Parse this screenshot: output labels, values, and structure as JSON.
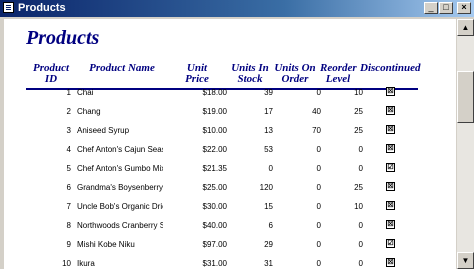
{
  "window": {
    "title": "Products",
    "min_label": "_",
    "max_label": "□",
    "close_label": "×"
  },
  "report": {
    "title": "Products",
    "headers": {
      "product_id": "Product ID",
      "product_name": "Product Name",
      "unit_price": "Unit Price",
      "units_in_stock_1": "Units In",
      "units_in_stock_2": "Stock",
      "units_on_order_1": "Units On",
      "units_on_order_2": "Order",
      "reorder_level_1": "Reorder",
      "reorder_level_2": "Level",
      "discontinued": "Discontinued"
    },
    "rows": [
      {
        "id": "1",
        "name": "Chai",
        "price": "$18.00",
        "stock": "39",
        "order": "0",
        "reorder": "10",
        "discontinued": "☒"
      },
      {
        "id": "2",
        "name": "Chang",
        "price": "$19.00",
        "stock": "17",
        "order": "40",
        "reorder": "25",
        "discontinued": "☒"
      },
      {
        "id": "3",
        "name": "Aniseed Syrup",
        "price": "$10.00",
        "stock": "13",
        "order": "70",
        "reorder": "25",
        "discontinued": "☒"
      },
      {
        "id": "4",
        "name": "Chef Anton's Cajun Seasoning",
        "price": "$22.00",
        "stock": "53",
        "order": "0",
        "reorder": "0",
        "discontinued": "☒"
      },
      {
        "id": "5",
        "name": "Chef Anton's Gumbo Mix",
        "price": "$21.35",
        "stock": "0",
        "order": "0",
        "reorder": "0",
        "discontinued": "☑"
      },
      {
        "id": "6",
        "name": "Grandma's Boysenberry Sprea",
        "price": "$25.00",
        "stock": "120",
        "order": "0",
        "reorder": "25",
        "discontinued": "☒"
      },
      {
        "id": "7",
        "name": "Uncle Bob's Organic Dried Pe",
        "price": "$30.00",
        "stock": "15",
        "order": "0",
        "reorder": "10",
        "discontinued": "☒"
      },
      {
        "id": "8",
        "name": "Northwoods Cranberry Sauce",
        "price": "$40.00",
        "stock": "6",
        "order": "0",
        "reorder": "0",
        "discontinued": "☒"
      },
      {
        "id": "9",
        "name": "Mishi Kobe Niku",
        "price": "$97.00",
        "stock": "29",
        "order": "0",
        "reorder": "0",
        "discontinued": "☑"
      },
      {
        "id": "10",
        "name": "Ikura",
        "price": "$31.00",
        "stock": "31",
        "order": "0",
        "reorder": "0",
        "discontinued": "☒"
      }
    ]
  },
  "scrollbar": {
    "up_icon": "▲",
    "down_icon": "▼"
  }
}
